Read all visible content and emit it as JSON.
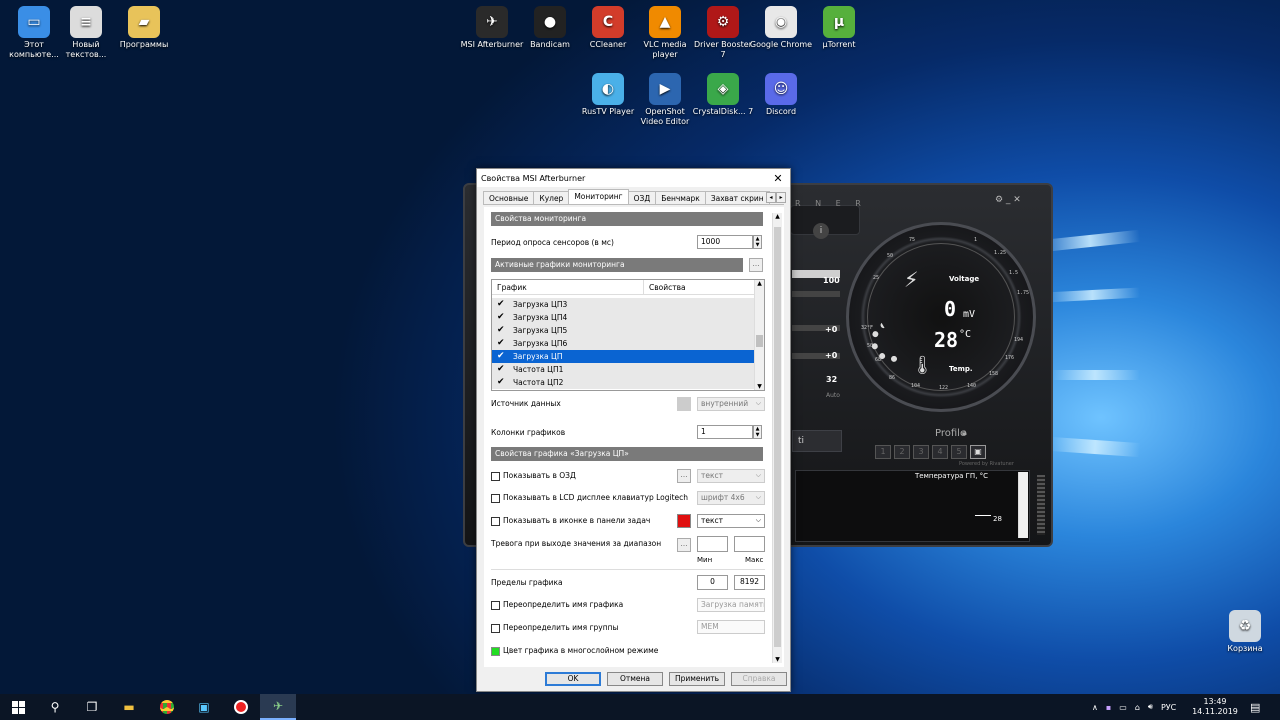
{
  "desktop_icons": [
    {
      "label": "Этот компьюте...",
      "color": "#3a8ee6"
    },
    {
      "label": "Новый текстов...",
      "color": "#dcdcdc"
    },
    {
      "label": "Программы",
      "color": "#e8c35a"
    },
    {
      "label": "MSI Afterburner",
      "color": "#2a2a2a"
    },
    {
      "label": "Bandicam",
      "color": "#222222"
    },
    {
      "label": "CCleaner",
      "color": "#d23c2a"
    },
    {
      "label": "VLC media player",
      "color": "#f08a00"
    },
    {
      "label": "Driver Booster 7",
      "color": "#b01818"
    },
    {
      "label": "Google Chrome",
      "color": "#e8e8e8"
    },
    {
      "label": "µTorrent",
      "color": "#56b03c"
    },
    {
      "label": "RusTV Player",
      "color": "#4ab0e8"
    },
    {
      "label": "OpenShot Video Editor",
      "color": "#2c66b0"
    },
    {
      "label": "CrystalDisk... 7",
      "color": "#3aa84a"
    },
    {
      "label": "Discord",
      "color": "#5a6ae8"
    },
    {
      "label": "Корзина",
      "color": "#cfd8e0"
    }
  ],
  "afterburner": {
    "brand": "R N E R",
    "info_icon": "i",
    "voltage_label": "Voltage",
    "voltage_value": "0",
    "voltage_unit": "mV",
    "temp_value": "28",
    "temp_unit": "°C",
    "temp_label": "Temp.",
    "left_values": [
      "100",
      "+0",
      "+0",
      "32"
    ],
    "auto_label": "Auto",
    "profile_label": "Profile",
    "profile_slots": [
      "1",
      "2",
      "3",
      "4",
      "5"
    ],
    "powered_by": "Powered by Rivatuner",
    "graph_title": "Температура ГП, °С",
    "graph_value": "28",
    "gauge_ticks": [
      "75",
      "50",
      "25",
      "1",
      "1.25",
      "1.5",
      "1.75",
      "32°F",
      "50",
      "68",
      "86",
      "104",
      "122",
      "140",
      "158",
      "176",
      "194"
    ]
  },
  "dialog": {
    "title": "Свойства MSI Afterburner",
    "close_glyph": "✕",
    "tabs": [
      "Основные",
      "Кулер",
      "Мониторинг",
      "ОЗД",
      "Бенчмарк",
      "Захват скрин"
    ],
    "active_tab": "Мониторинг",
    "section_monitoring": "Свойства мониторинга",
    "poll_label": "Период опроса сенсоров (в мс)",
    "poll_value": "1000",
    "section_active": "Активные графики мониторинга",
    "list_headers": [
      "График",
      "Свойства"
    ],
    "list_items": [
      {
        "label": "Загрузка ЦП3",
        "selected": false
      },
      {
        "label": "Загрузка ЦП4",
        "selected": false
      },
      {
        "label": "Загрузка ЦП5",
        "selected": false
      },
      {
        "label": "Загрузка ЦП6",
        "selected": false
      },
      {
        "label": "Загрузка ЦП",
        "selected": true
      },
      {
        "label": "Частота ЦП1",
        "selected": false
      },
      {
        "label": "Частота ЦП2",
        "selected": false
      }
    ],
    "source_label": "Источник данных",
    "source_value": "внутренний",
    "columns_label": "Колонки графиков",
    "columns_value": "1",
    "section_graph": "Свойства графика «Загрузка ЦП»",
    "osd_label": "Показывать в ОЗД",
    "osd_value": "текст",
    "lcd_label": "Показывать в LCD дисплее клавиатур Logitech",
    "lcd_value": "шрифт 4x6",
    "tray_label": "Показывать в иконке в панели задач",
    "tray_value": "текст",
    "tray_color": "#e01010",
    "alarm_label": "Тревога при выходе значения за диапазон",
    "min_label": "Мин",
    "max_label": "Макс",
    "limits_label": "Пределы графика",
    "limit_min": "0",
    "limit_max": "8192",
    "override_name_label": "Переопределить имя графика",
    "override_name_value": "Загрузка памяти",
    "override_group_label": "Переопределить имя группы",
    "override_group_value": "MEM",
    "multilayer_label": "Цвет графика в многослойном режиме",
    "multilayer_color": "#22dd22",
    "buttons": {
      "ok": "OK",
      "cancel": "Отмена",
      "apply": "Применить",
      "help": "Справка"
    }
  },
  "taskbar": {
    "lang": "РУС",
    "time": "13:49",
    "date": "14.11.2019",
    "chevron": "∧"
  }
}
